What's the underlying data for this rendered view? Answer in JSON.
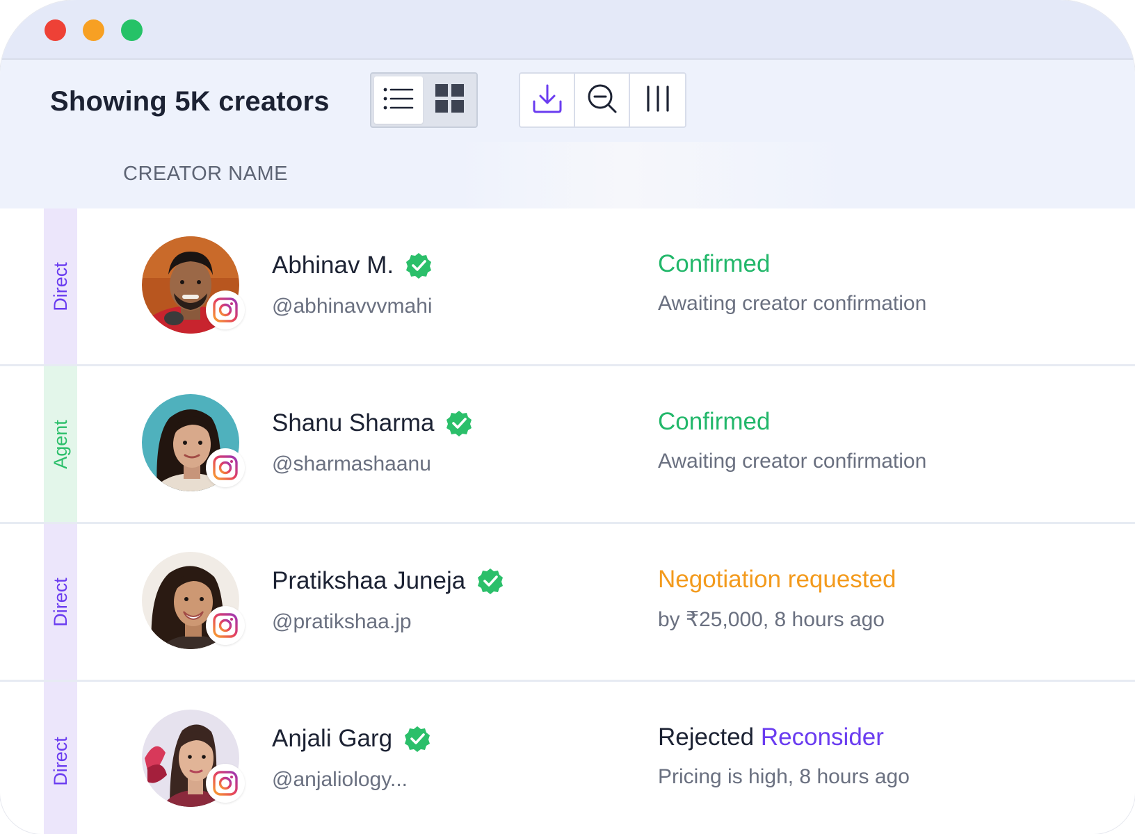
{
  "window": {
    "controls": [
      "close",
      "minimize",
      "maximize"
    ]
  },
  "toolbar": {
    "title": "Showing 5K creators",
    "view_modes": [
      "list",
      "grid"
    ],
    "active_view": "list",
    "actions": [
      "download-icon",
      "zoom-out-icon",
      "columns-icon"
    ]
  },
  "table": {
    "column_header": "CREATOR NAME",
    "rows": [
      {
        "tag": "Direct",
        "name": "Abhinav M.",
        "handle": "@abhinavvvmahi",
        "status": "Confirmed",
        "status_link": "",
        "detail": "Awaiting creator confirmation"
      },
      {
        "tag": "Agent",
        "name": "Shanu Sharma",
        "handle": "@sharmashaanu",
        "status": "Confirmed",
        "status_link": "",
        "detail": "Awaiting creator confirmation"
      },
      {
        "tag": "Direct",
        "name": "Pratikshaa Juneja",
        "handle": "@pratikshaa.jp",
        "status": "Negotiation requested",
        "status_link": "",
        "detail": "by ₹25,000, 8 hours ago"
      },
      {
        "tag": "Direct",
        "name": "Anjali Garg",
        "handle": "@anjaliology...",
        "status": "Rejected",
        "status_link": "Reconsider",
        "detail": "Pricing is high, 8 hours ago"
      }
    ]
  },
  "colors": {
    "accent": "#6a3cf0",
    "confirmed": "#22b76a",
    "negotiation": "#f39a1c",
    "verified": "#2bbf6a"
  }
}
